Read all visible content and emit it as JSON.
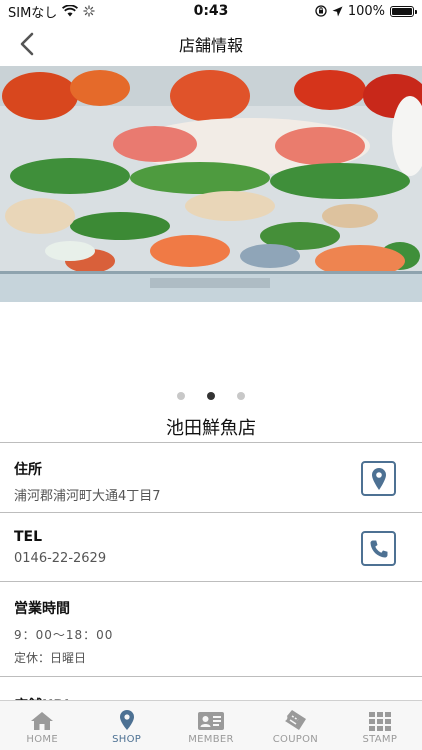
{
  "status_bar": {
    "carrier": "SIMなし",
    "time": "0:43",
    "battery": "100%"
  },
  "nav": {
    "title": "店舗情報"
  },
  "carousel": {
    "page_count": 3,
    "active_index": 1
  },
  "shop": {
    "name": "池田鮮魚店",
    "address_label": "住所",
    "address": "浦河郡浦河町大通4丁目7",
    "tel_label": "TEL",
    "tel": "0146-22-2629",
    "hours_label": "営業時間",
    "hours": "9：00〜18：00",
    "closed": "定休：日曜日",
    "url_label": "店舗URL"
  },
  "tabs": [
    {
      "label": "HOME",
      "icon": "home-icon"
    },
    {
      "label": "SHOP",
      "icon": "map-pin-icon"
    },
    {
      "label": "MEMBER",
      "icon": "id-card-icon"
    },
    {
      "label": "COUPON",
      "icon": "coupon-ticket-icon"
    },
    {
      "label": "STAMP",
      "icon": "grid-icon"
    }
  ],
  "colors": {
    "accent": "#4d7193",
    "inactive_tab": "#9a9a9a"
  }
}
